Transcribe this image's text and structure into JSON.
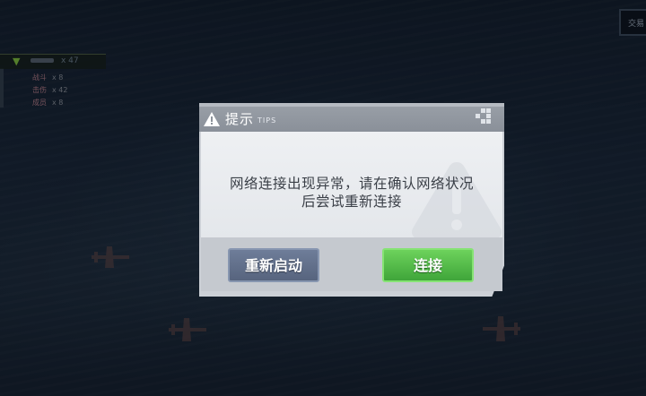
{
  "corner": {
    "label": "交易"
  },
  "stats": {
    "header_count": "x 47",
    "rows": [
      {
        "label": "战斗",
        "value": "x 8"
      },
      {
        "label": "击伤",
        "value": "x 42"
      },
      {
        "label": "成员",
        "value": "x 8"
      }
    ]
  },
  "dialog": {
    "title": "提示",
    "subtitle": "TIPS",
    "message_line1": "网络连接出现异常，请在确认网络状况",
    "message_line2": "后尝试重新连接",
    "buttons": {
      "restart": "重新启动",
      "connect": "连接"
    }
  },
  "colors": {
    "accent_green": "#4cb944",
    "button_gray_blue": "#5f6d88",
    "dialog_header": "#9aa0a8"
  },
  "icons": [
    "warning-icon",
    "warning-watermark-icon",
    "fold-arrow-icon",
    "aircraft-icon"
  ]
}
